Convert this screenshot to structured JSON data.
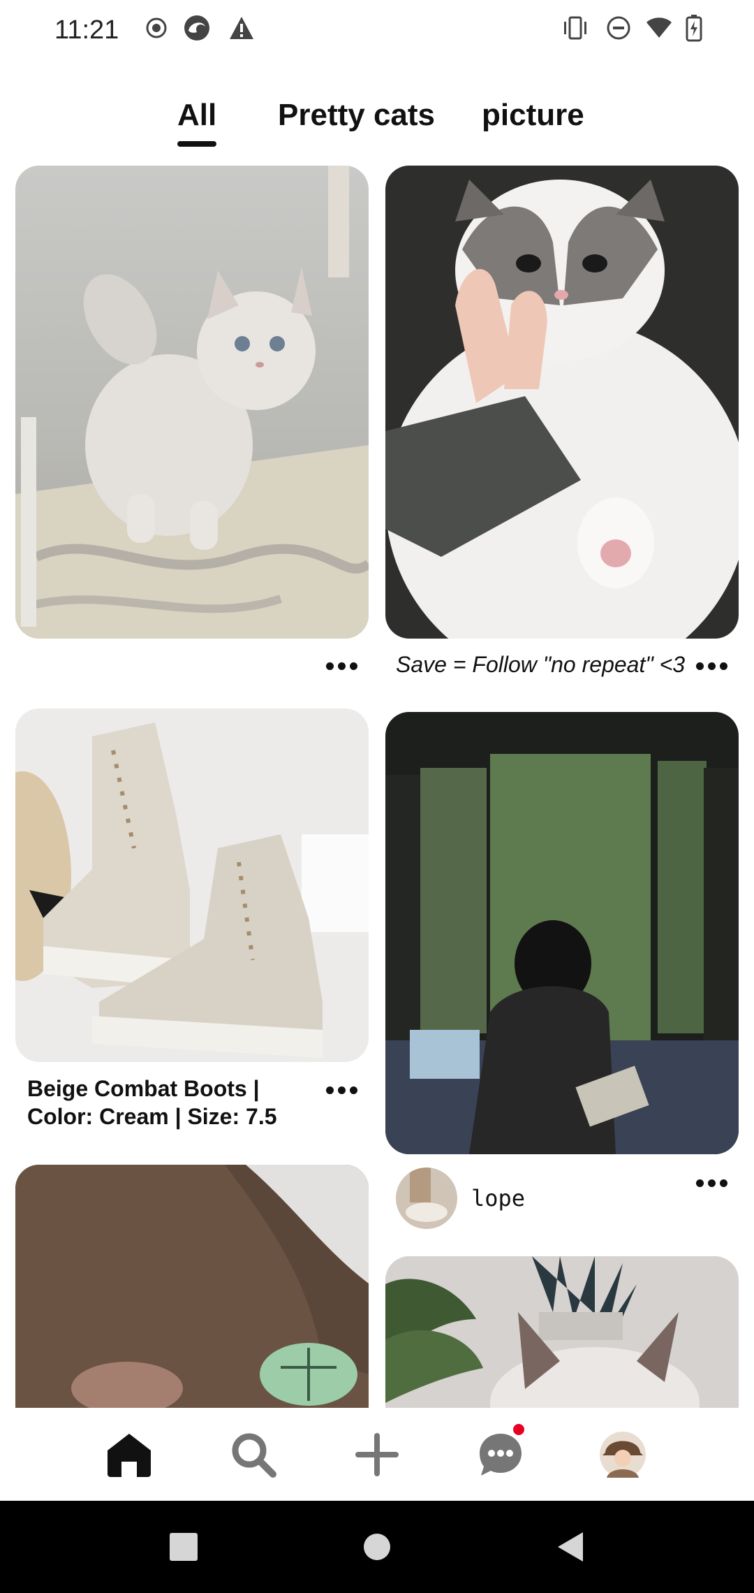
{
  "status_bar": {
    "time": "11:21",
    "left_icons": [
      "record-icon",
      "browser-icon",
      "warning-icon"
    ],
    "right_icons": [
      "vibrate-icon",
      "do-not-disturb-icon",
      "wifi-icon",
      "battery-icon"
    ]
  },
  "tabs": [
    {
      "label": "All",
      "selected": true
    },
    {
      "label": "Pretty cats",
      "selected": false
    },
    {
      "label": "picture",
      "selected": false
    }
  ],
  "feed": {
    "pins": [
      {
        "id": "kitten-grey",
        "image": "fluffy grey kitten on rug",
        "caption": ""
      },
      {
        "id": "cat-hand",
        "image": "white and grey cat with hand",
        "caption": "Save = Follow \"no repeat\" <3"
      },
      {
        "id": "boots",
        "image": "beige combat boots",
        "caption_line1": "Beige Combat Boots |",
        "caption_line2": "Color: Cream | Size: 7.5"
      },
      {
        "id": "rain-window",
        "image": "illustration of person at rainy window",
        "username": "lope"
      },
      {
        "id": "brown-chair",
        "image": "brown chair with plush turtle"
      },
      {
        "id": "cat-plants",
        "image": "siamese cat near plants"
      }
    ]
  },
  "bottom_nav": {
    "items": [
      "home-icon",
      "search-icon",
      "create-icon",
      "messages-icon",
      "profile-avatar"
    ],
    "messages_has_notification": true
  },
  "system_nav": [
    "recents-button",
    "home-button",
    "back-button"
  ],
  "colors": {
    "accent": "#e60023",
    "text": "#111111",
    "background": "#ffffff"
  }
}
